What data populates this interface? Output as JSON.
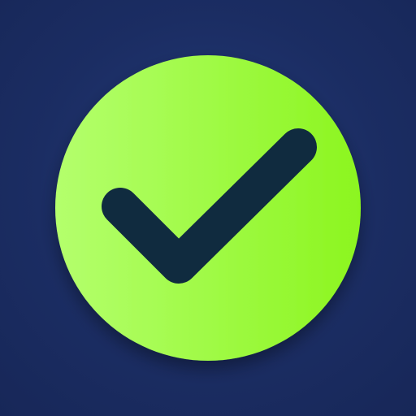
{
  "app_icon": {
    "icon": "checkmark-icon",
    "colors": {
      "background": "#1b2d63",
      "circle_left": "#b4ff6d",
      "circle_right": "#8cf51f",
      "checkmark": "#102b3f"
    }
  }
}
